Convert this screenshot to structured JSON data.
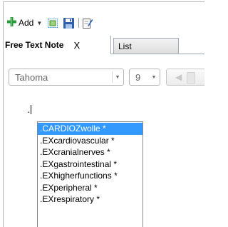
{
  "toolbar": {
    "add_label": "Add",
    "icons": [
      "plus-icon",
      "caret-down-icon",
      "screenshot-icon",
      "save-icon",
      "edit-document-icon"
    ]
  },
  "tabs": [
    {
      "label": "Free Text Note",
      "close": "X",
      "active": true
    },
    {
      "label": "List",
      "active": false
    }
  ],
  "format_bar": {
    "font": "Tahoma",
    "size": "9"
  },
  "editor": {
    "typed_text": "."
  },
  "autocomplete": {
    "items": [
      ".CARDIOZwolle *",
      ".EXcardiovascular *",
      ".EXcranialnerves *",
      ".EXgastrointestinal *",
      ".EXhigherfunctions *",
      ".EXperipheral *",
      ".EXrespiratory *"
    ],
    "selected_index": 0
  },
  "colors": {
    "selection": "#3399ff",
    "plus_green": "#2b9b3a",
    "save_blue": "#2f5fa8"
  }
}
